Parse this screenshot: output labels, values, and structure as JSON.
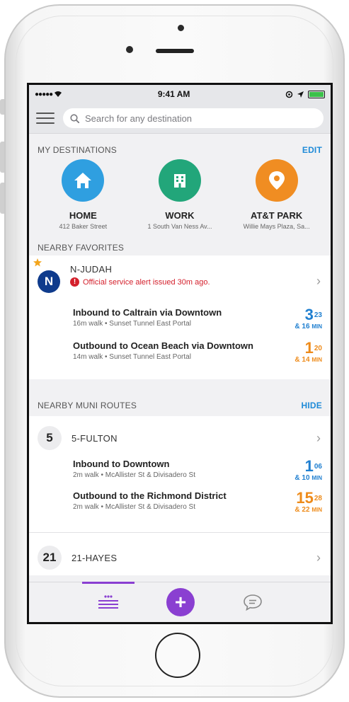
{
  "status_bar": {
    "signal": "●●●●●",
    "time": "9:41 AM"
  },
  "search": {
    "placeholder": "Search for any destination"
  },
  "my_destinations": {
    "heading": "MY DESTINATIONS",
    "action": "EDIT",
    "items": [
      {
        "name": "HOME",
        "address": "412 Baker Street",
        "color": "#2f9fe0",
        "icon": "home-icon"
      },
      {
        "name": "WORK",
        "address": "1 South Van Ness Av...",
        "color": "#22a67a",
        "icon": "building-icon"
      },
      {
        "name": "AT&T PARK",
        "address": "Willie Mays Plaza, Sa...",
        "color": "#f08d22",
        "icon": "location-pin-icon"
      }
    ]
  },
  "nearby_favorites": {
    "heading": "NEARBY FAVORITES",
    "route": {
      "badge": "N",
      "name": "N-JUDAH",
      "alert": "Official service alert issued 30m ago.",
      "trips": [
        {
          "direction": "Inbound to Caltrain via Downtown",
          "walk": "16m walk • Sunset Tunnel East Portal",
          "time_main": "3",
          "time_sup": "23",
          "time_next": "& 16",
          "unit": "MIN",
          "color": "#1f7fd0"
        },
        {
          "direction": "Outbound to Ocean Beach via Downtown",
          "walk": "14m walk • Sunset Tunnel East Portal",
          "time_main": "1",
          "time_sup": "20",
          "time_next": "& 14",
          "unit": "MIN",
          "color": "#ee8b1a"
        }
      ]
    }
  },
  "nearby_muni": {
    "heading": "NEARBY MUNI ROUTES",
    "action": "HIDE",
    "routes": [
      {
        "badge": "5",
        "name": "5-FULTON",
        "trips": [
          {
            "direction": "Inbound to Downtown",
            "walk": "2m walk • McAllister St & Divisadero St",
            "time_main": "1",
            "time_sup": "06",
            "time_next": "& 10",
            "unit": "MIN",
            "color": "#1f7fd0"
          },
          {
            "direction": "Outbound to the Richmond District",
            "walk": "2m walk • McAllister St & Divisadero St",
            "time_main": "15",
            "time_sup": "28",
            "time_next": "& 22",
            "unit": "MIN",
            "color": "#ee8b1a"
          }
        ]
      },
      {
        "badge": "21",
        "name": "21-HAYES"
      }
    ]
  },
  "tabbar": {
    "tabs": [
      "list-icon",
      "add-icon",
      "chat-icon"
    ],
    "fab_label": "+",
    "accent": "#8a3fd1"
  }
}
